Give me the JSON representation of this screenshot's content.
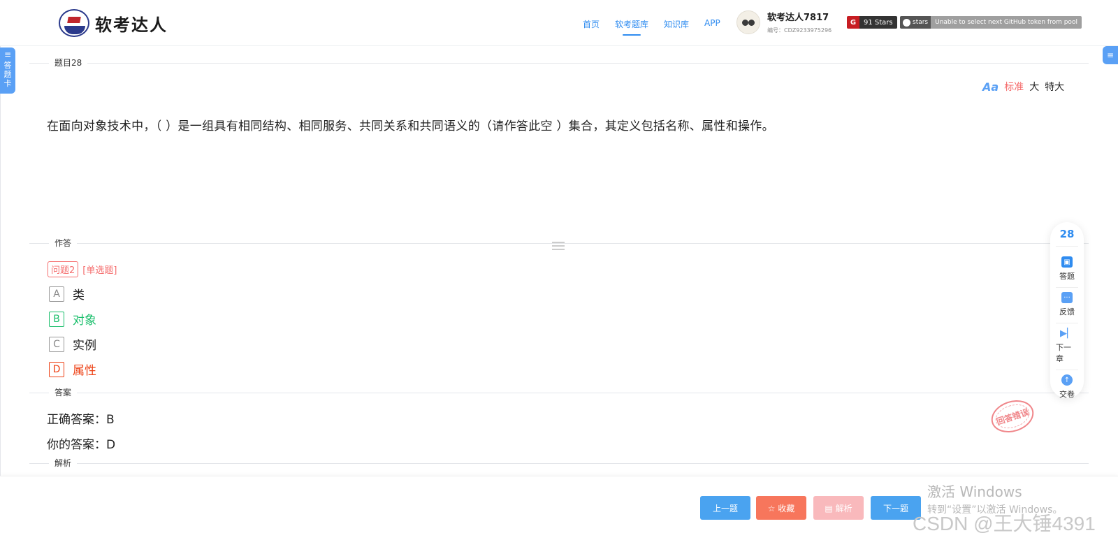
{
  "header": {
    "logo_text": "软考达人",
    "nav": [
      {
        "label": "首页",
        "active": false
      },
      {
        "label": "软考题库",
        "active": true
      },
      {
        "label": "知识库",
        "active": false
      },
      {
        "label": "APP",
        "active": false
      }
    ],
    "user": {
      "name": "软考达人7817",
      "id": "编号：CDZ9233975296"
    },
    "gitee_badge": {
      "logo": "G",
      "text": "91 Stars"
    },
    "github_badge": {
      "label": "stars",
      "message": "Unable to select next GitHub token from pool"
    }
  },
  "left_tab": {
    "icon": "≡",
    "label": [
      "答",
      "题",
      "卡"
    ]
  },
  "right_tab": {
    "icon": "≡"
  },
  "question_section": {
    "label": "题目28"
  },
  "font_switch": {
    "icon": "Aa",
    "options": [
      "标准",
      "大",
      "特大"
    ],
    "selected": "标准"
  },
  "question": {
    "text": "在面向对象技术中，（ ）是一组具有相同结构、相同服务、共同关系和共同语义的（请作答此空 ）集合，其定义包括名称、属性和操作。"
  },
  "answer_section": {
    "label": "作答"
  },
  "sub_question": {
    "tag": "问题2",
    "type": "[单选题]"
  },
  "options": [
    {
      "letter": "A",
      "text": "类",
      "state": "normal"
    },
    {
      "letter": "B",
      "text": "对象",
      "state": "correct"
    },
    {
      "letter": "C",
      "text": "实例",
      "state": "normal"
    },
    {
      "letter": "D",
      "text": "属性",
      "state": "wrong"
    }
  ],
  "result_section": {
    "label": "答案"
  },
  "result": {
    "correct_label": "正确答案：B",
    "yours_label": "你的答案：D",
    "stamp": "回答错误"
  },
  "analysis_section": {
    "label": "解析"
  },
  "sidebar": {
    "number": "28",
    "items": [
      {
        "label": "答题",
        "icon": "answer-icon"
      },
      {
        "label": "反馈",
        "icon": "feedback-icon"
      },
      {
        "label": "下一章",
        "icon": "next-chapter-icon"
      },
      {
        "label": "交卷",
        "icon": "submit-icon"
      }
    ]
  },
  "buttons": {
    "prev": "上一题",
    "favorite": "☆ 收藏",
    "analysis": "▤ 解析",
    "next": "下一题"
  },
  "watermarks": {
    "windows_title": "激活 Windows",
    "windows_sub": "转到“设置”以激活 Windows。",
    "csdn": "CSDN @王大锤4391"
  },
  "colors": {
    "primary": "#2f8cf0",
    "correct": "#19be6b",
    "wrong": "#ed4014",
    "accent": "#f56c6c"
  }
}
